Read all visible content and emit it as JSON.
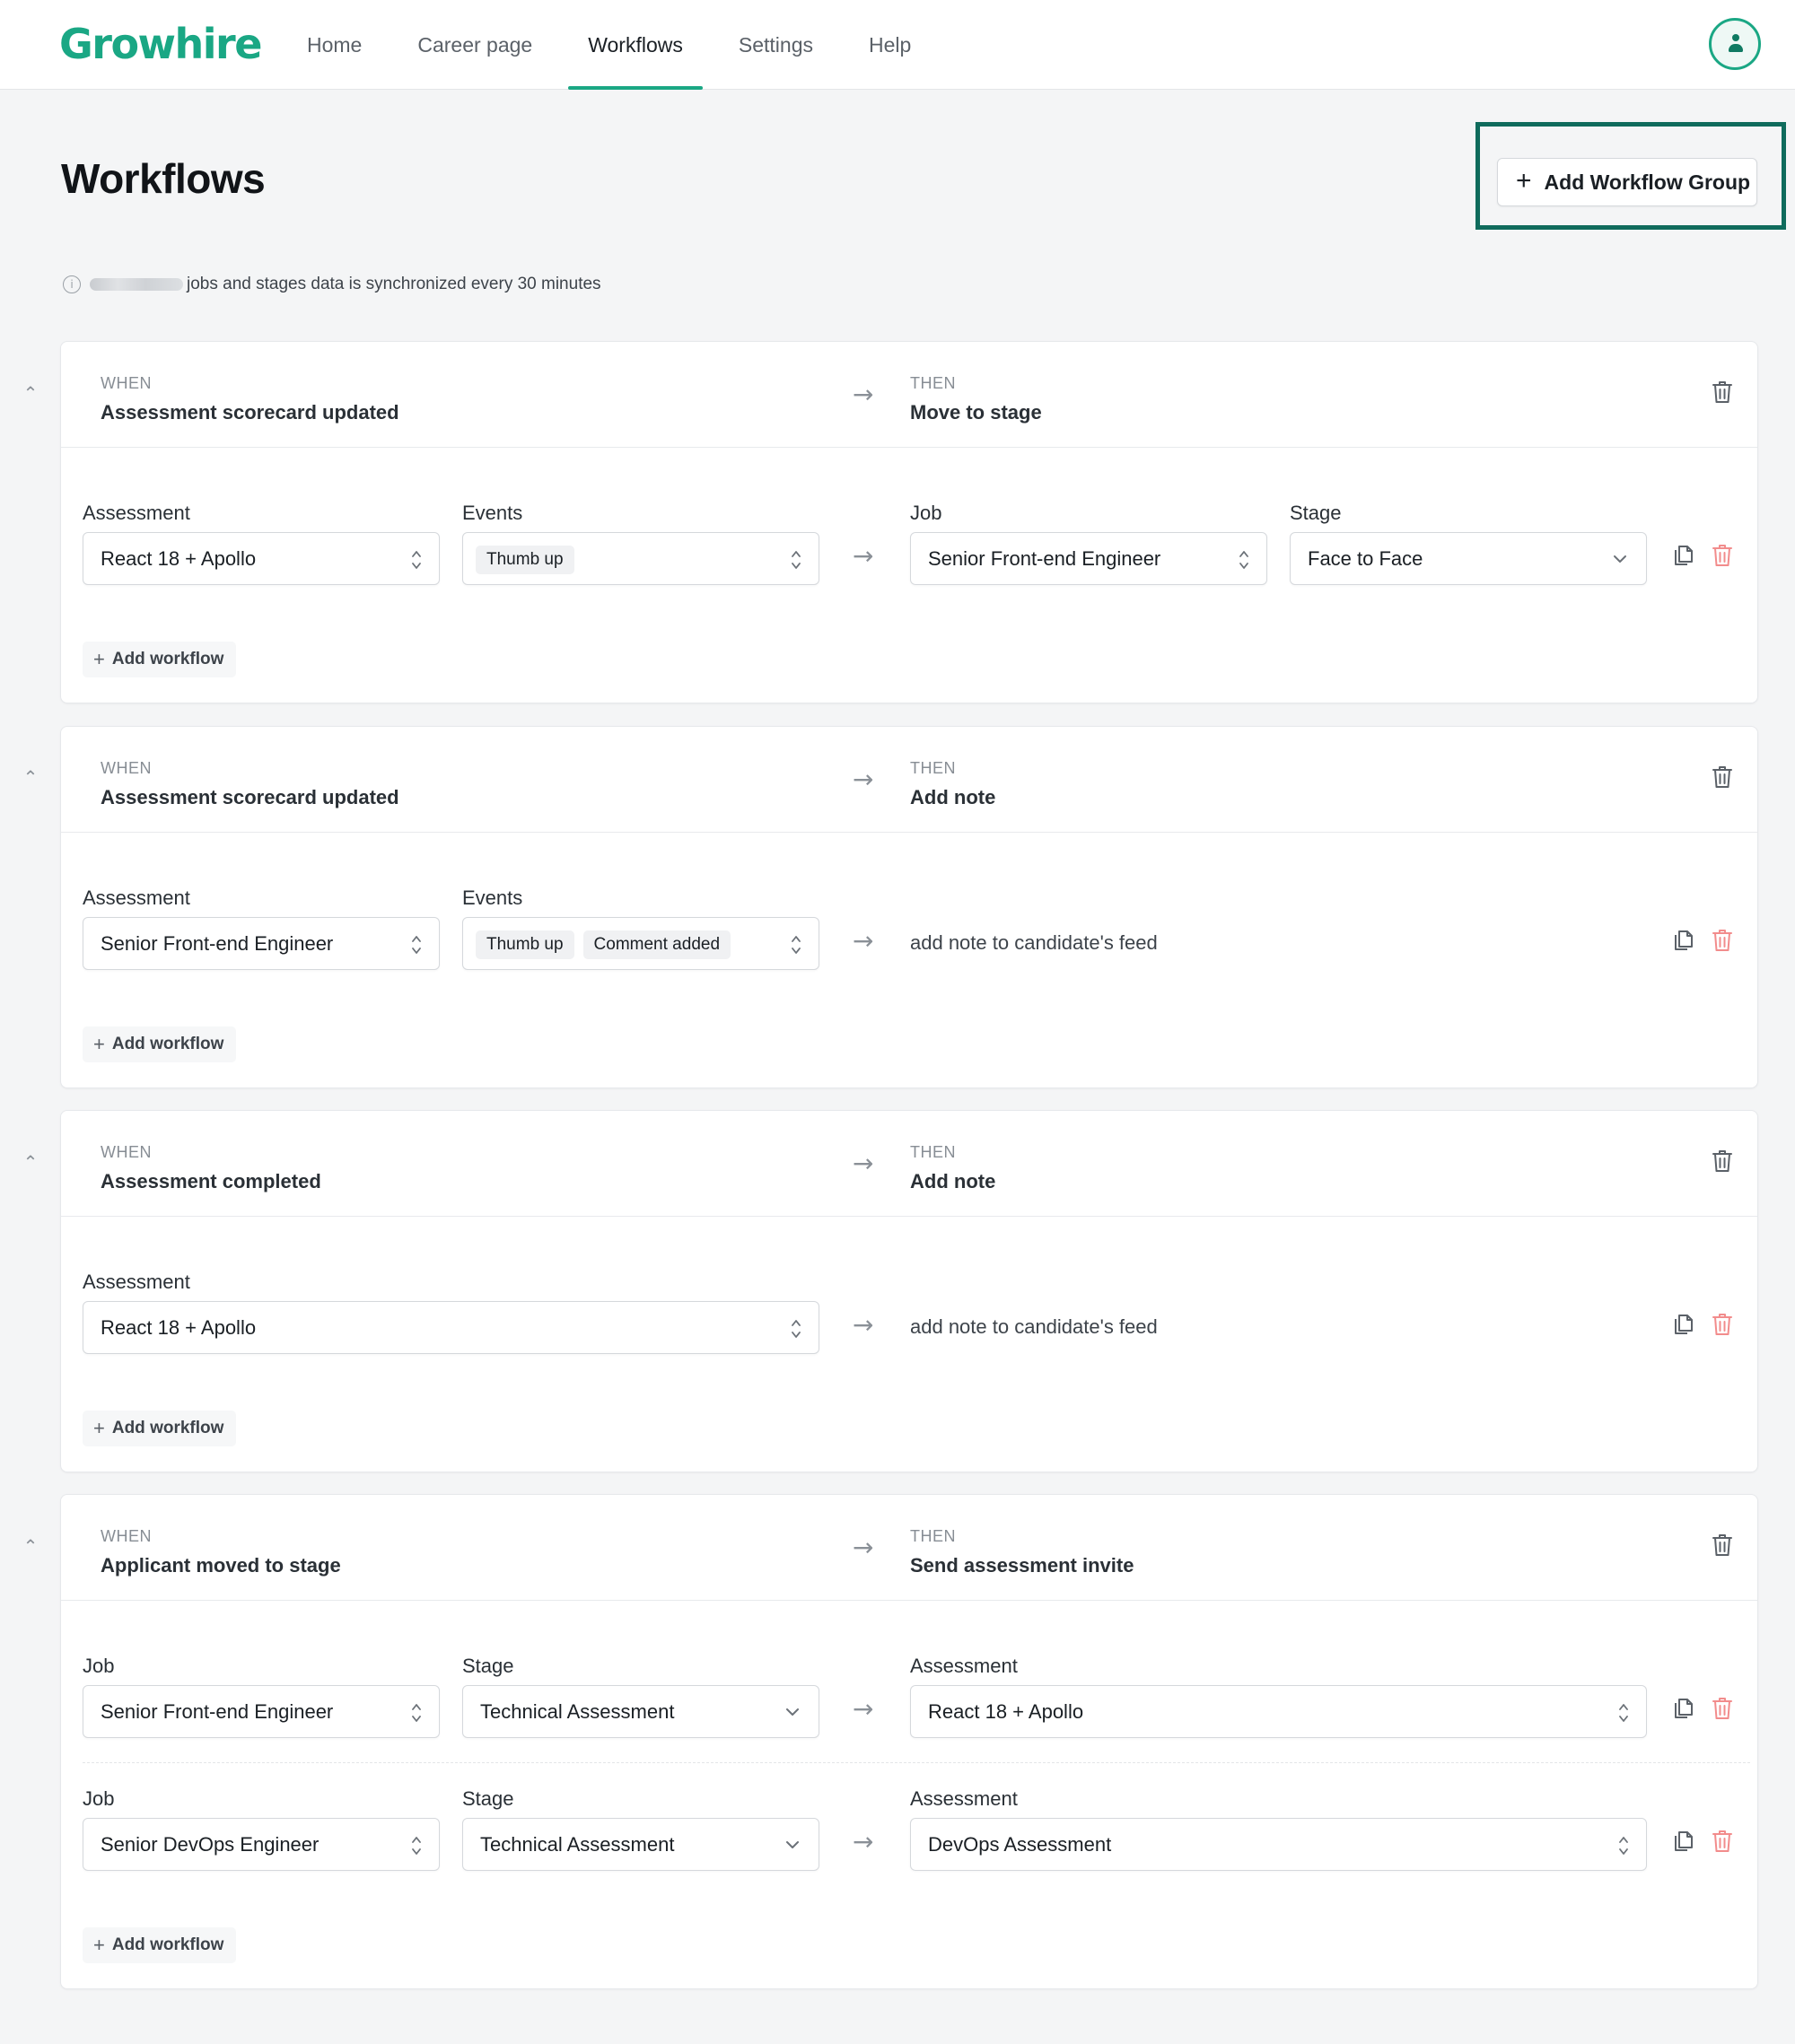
{
  "app": {
    "logo": "Growhire"
  },
  "nav": [
    {
      "label": "Home",
      "active": false
    },
    {
      "label": "Career page",
      "active": false
    },
    {
      "label": "Workflows",
      "active": true
    },
    {
      "label": "Settings",
      "active": false
    },
    {
      "label": "Help",
      "active": false
    }
  ],
  "page": {
    "title": "Workflows",
    "add_group_label": "Add Workflow Group",
    "sync_note": "jobs and stages data is synchronized every 30 minutes"
  },
  "labels": {
    "when": "WHEN",
    "then": "THEN",
    "add_workflow": "Add workflow",
    "arrow": "→"
  },
  "groups": [
    {
      "when": "Assessment scorecard updated",
      "then": "Move to stage",
      "rows": [
        {
          "assessment_label": "Assessment",
          "assessment": "React 18 + Apollo",
          "events_label": "Events",
          "events": [
            "Thumb up"
          ],
          "job_label": "Job",
          "job": "Senior Front-end Engineer",
          "stage_label": "Stage",
          "stage": "Face to Face"
        }
      ]
    },
    {
      "when": "Assessment scorecard updated",
      "then": "Add note",
      "rows": [
        {
          "assessment_label": "Assessment",
          "assessment": "Senior Front-end Engineer",
          "events_label": "Events",
          "events": [
            "Thumb up",
            "Comment added"
          ],
          "action_text": "add note to candidate's feed"
        }
      ]
    },
    {
      "when": "Assessment completed",
      "then": "Add note",
      "rows": [
        {
          "assessment_label": "Assessment",
          "assessment": "React 18 + Apollo",
          "action_text": "add note to candidate's feed"
        }
      ]
    },
    {
      "when": "Applicant moved to stage",
      "then": "Send assessment invite",
      "rows": [
        {
          "job_label": "Job",
          "job": "Senior Front-end Engineer",
          "stage_label": "Stage",
          "stage": "Technical Assessment",
          "assessment_label": "Assessment",
          "assessment": "React 18 + Apollo"
        },
        {
          "job_label": "Job",
          "job": "Senior DevOps Engineer",
          "stage_label": "Stage",
          "stage": "Technical Assessment",
          "assessment_label": "Assessment",
          "assessment": "DevOps Assessment"
        }
      ]
    }
  ],
  "icons": {
    "collapse": "chevron-up-icon",
    "delete": "trash-icon",
    "copy": "copy-icon",
    "info": "info-icon",
    "add": "plus-icon"
  },
  "colors": {
    "brand": "#1aa784",
    "highlight": "#0f6b5c",
    "danger": "#f28c8c"
  }
}
